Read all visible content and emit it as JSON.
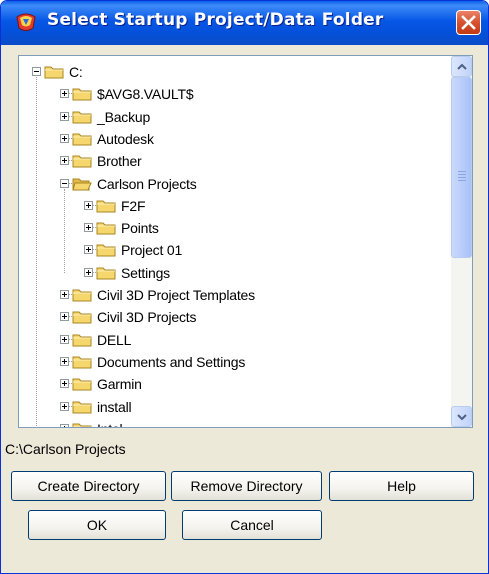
{
  "window": {
    "title": "Select Startup Project/Data Folder",
    "icons": {
      "app": "app-logo-icon",
      "close": "close-icon"
    }
  },
  "tree": {
    "items": [
      {
        "label": "C:",
        "level": 0,
        "expanded": true,
        "open_folder": false
      },
      {
        "label": "$AVG8.VAULT$",
        "level": 1,
        "expanded": false,
        "open_folder": false
      },
      {
        "label": "_Backup",
        "level": 1,
        "expanded": false,
        "open_folder": false
      },
      {
        "label": "Autodesk",
        "level": 1,
        "expanded": false,
        "open_folder": false
      },
      {
        "label": "Brother",
        "level": 1,
        "expanded": false,
        "open_folder": false
      },
      {
        "label": "Carlson Projects",
        "level": 1,
        "expanded": true,
        "open_folder": true
      },
      {
        "label": "F2F",
        "level": 2,
        "expanded": false,
        "open_folder": false
      },
      {
        "label": "Points",
        "level": 2,
        "expanded": false,
        "open_folder": false
      },
      {
        "label": "Project 01",
        "level": 2,
        "expanded": false,
        "open_folder": false
      },
      {
        "label": "Settings",
        "level": 2,
        "expanded": false,
        "open_folder": false
      },
      {
        "label": "Civil 3D Project Templates",
        "level": 1,
        "expanded": false,
        "open_folder": false
      },
      {
        "label": "Civil 3D Projects",
        "level": 1,
        "expanded": false,
        "open_folder": false
      },
      {
        "label": "DELL",
        "level": 1,
        "expanded": false,
        "open_folder": false
      },
      {
        "label": "Documents and Settings",
        "level": 1,
        "expanded": false,
        "open_folder": false
      },
      {
        "label": "Garmin",
        "level": 1,
        "expanded": false,
        "open_folder": false
      },
      {
        "label": "install",
        "level": 1,
        "expanded": false,
        "open_folder": false
      },
      {
        "label": "Intel",
        "level": 1,
        "expanded": false,
        "open_folder": false
      }
    ],
    "icons": {
      "folder": "folder-icon",
      "open_folder": "folder-open-icon",
      "expand": "plus-icon",
      "collapse": "minus-icon"
    }
  },
  "scrollbar": {
    "position_fraction": 0.0,
    "visible_fraction": 0.55,
    "icons": {
      "up": "arrow-up-icon",
      "down": "arrow-down-icon"
    }
  },
  "selected_path": "C:\\Carlson Projects",
  "buttons": {
    "create_directory": "Create Directory",
    "remove_directory": "Remove Directory",
    "help": "Help",
    "ok": "OK",
    "cancel": "Cancel"
  },
  "colors": {
    "title_bar": "#0A5FE9",
    "dialog_bg": "#ECE9D8",
    "close_button": "#D9512C",
    "folder": "#F5D76E",
    "scroll_thumb": "#B6CBFA"
  }
}
